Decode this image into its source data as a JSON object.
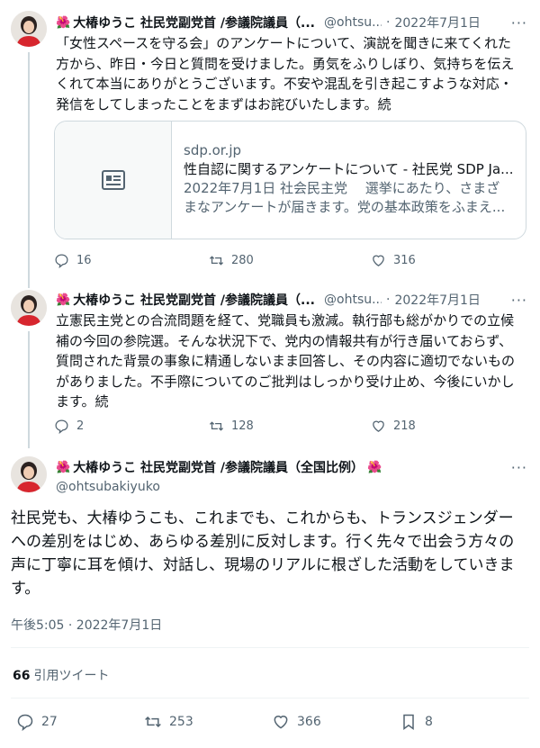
{
  "tweets": [
    {
      "display_name": "大椿ゆうこ 社民党副党首 /参議院議員（...",
      "handle": "@ohtsu...",
      "date": "2022年7月1日",
      "text_lines": [
        "「女性スペースを守る会」のアンケートについて、演説を聞きに来てくれた",
        "方から、昨日・今日と質問を受けました。勇気をふりしぼり、気持ちを伝え",
        "くれて本当にありがとうございます。不安や混乱を引き起こすような対応・",
        "発信をしてしまったことをまずはお詫びいたします。続"
      ],
      "card": {
        "domain": "sdp.or.jp",
        "title": "性自認に関するアンケートについて - 社民党 SDP Ja...",
        "desc_lines": [
          "2022年7月1日 社会民主党 　選挙にあたり、さまざ",
          "まなアンケートが届きます。党の基本政策をふまえ..."
        ]
      },
      "replies": "16",
      "retweets": "280",
      "likes": "316"
    },
    {
      "display_name": "大椿ゆうこ 社民党副党首 /参議院議員（...",
      "handle": "@ohtsu...",
      "date": "2022年7月1日",
      "text_lines": [
        "立憲民主党との合流問題を経て、党職員も激減。執行部も総がかりでの立候",
        "補の今回の参院選。そんな状況下で、党内の情報共有が行き届いておらず、",
        "質問された背景の事象に精通しないまま回答し、その内容に適切でないもの",
        "がありました。不手際についてのご批判はしっかり受け止め、今後にいかし",
        "ます。続"
      ],
      "replies": "2",
      "retweets": "128",
      "likes": "218"
    }
  ],
  "main": {
    "display_name": "大椿ゆうこ 社民党副党首 /参議院議員（全国比例）",
    "handle": "@ohtsubakiyuko",
    "text_lines": [
      "社民党も、大椿ゆうこも、これまでも、これからも、トランスジェンダー",
      "への差別をはじめ、あらゆる差別に反対します。行く先々で出会う方々の",
      "声に丁寧に耳を傾け、対話し、現場のリアルに根ざした活動をしていきま",
      "す。"
    ],
    "timestamp": "午後5:05 · 2022年7月1日",
    "quote_count": "66",
    "quote_label": "引用ツイート",
    "replies": "27",
    "retweets": "253",
    "likes": "366",
    "bookmarks": "8"
  },
  "separator": "·",
  "more_label": "···",
  "flower_emoji": "🌺",
  "colors": {
    "accent_flower": "#e0245e",
    "muted": "#536471",
    "border": "#cfd9de"
  }
}
